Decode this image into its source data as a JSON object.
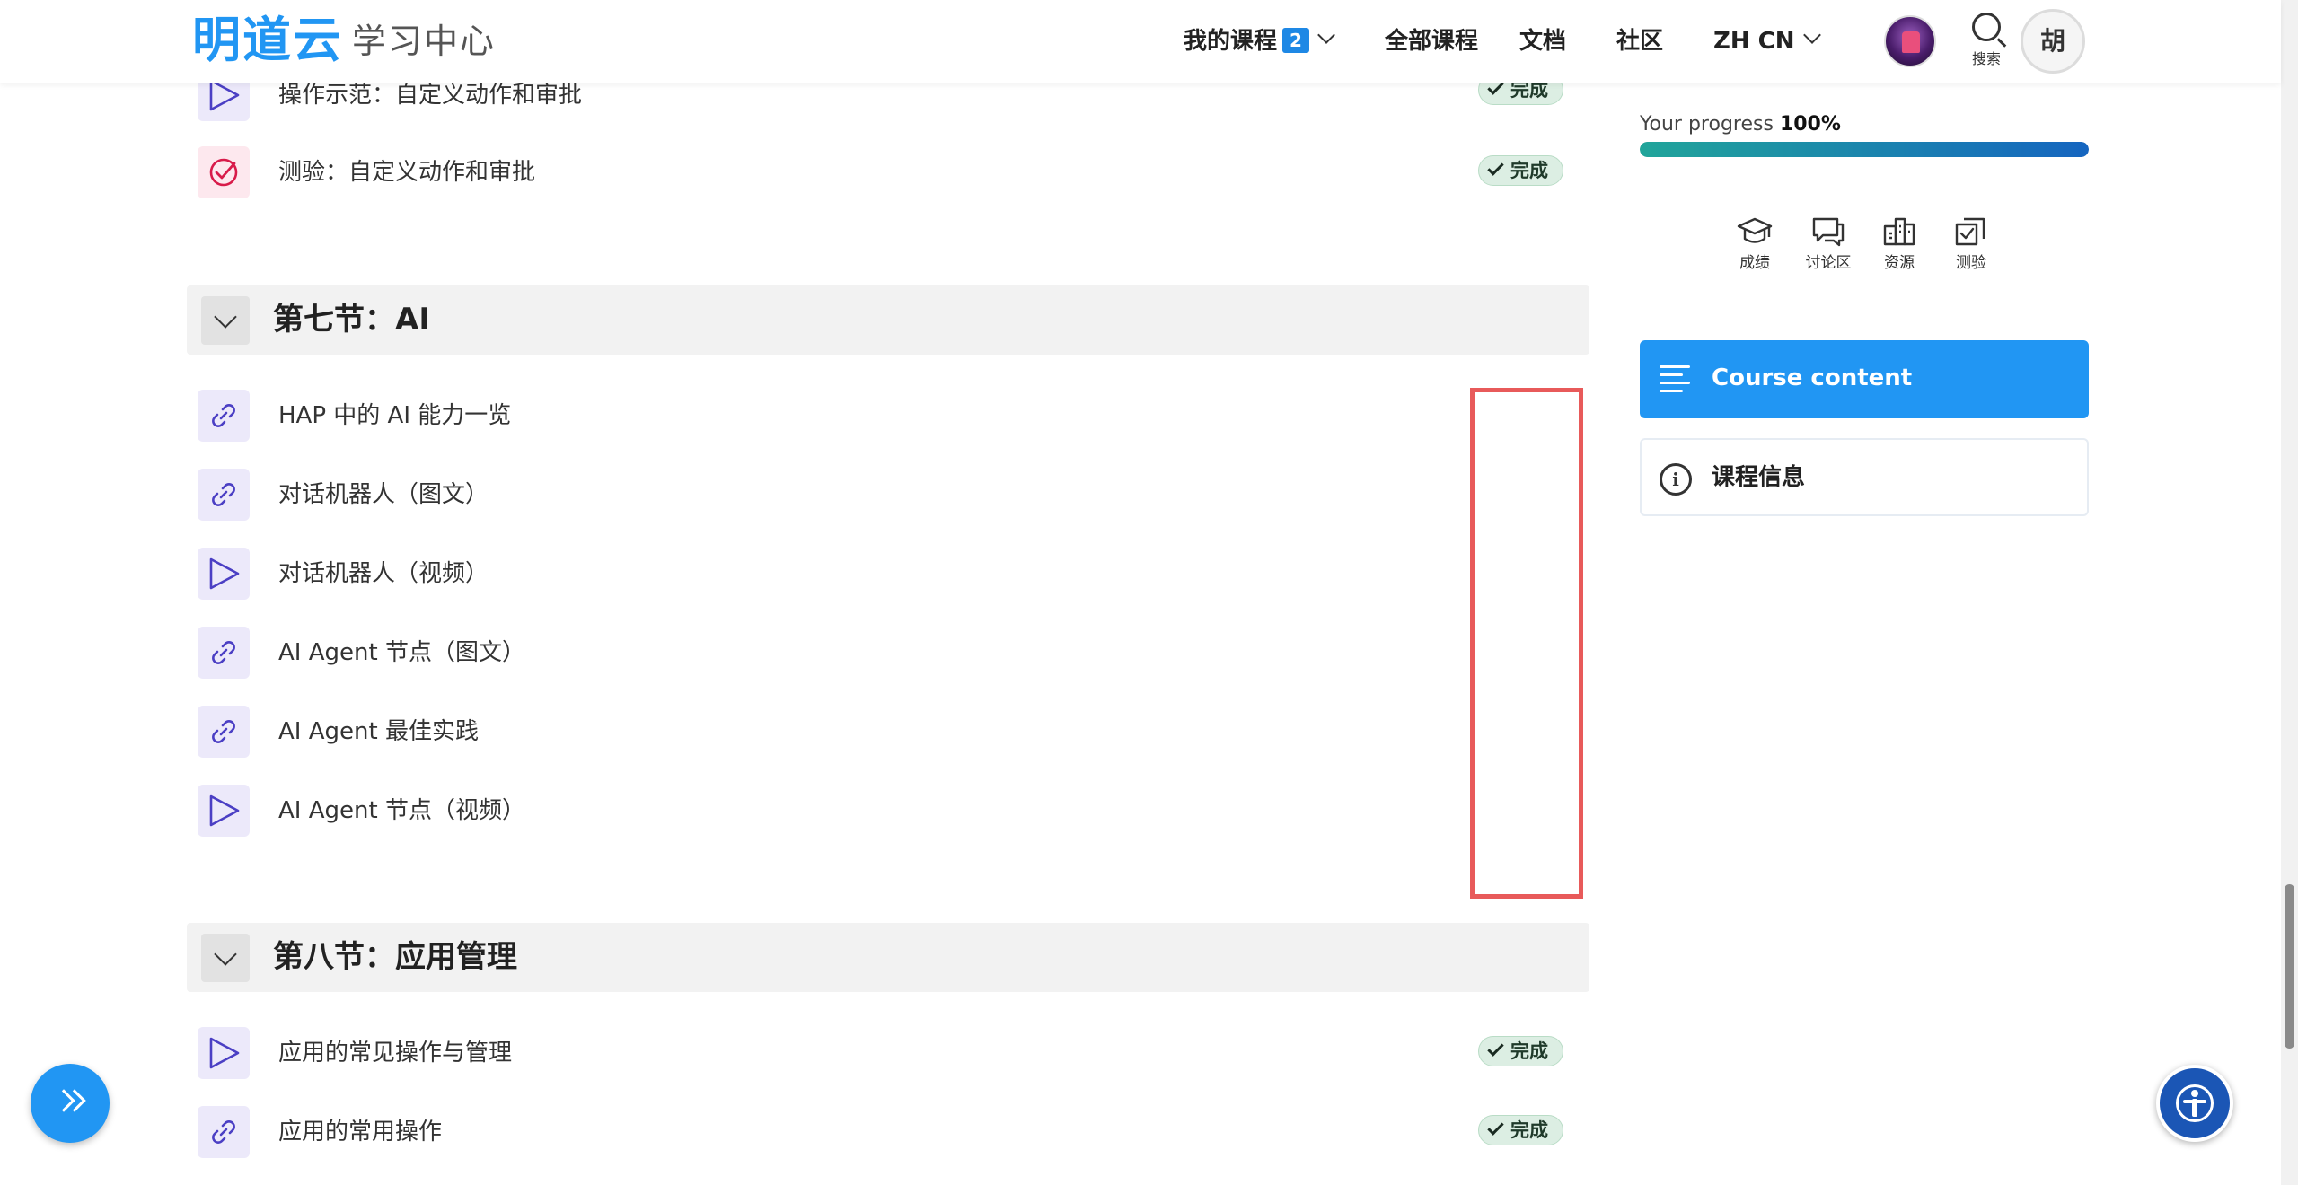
{
  "header": {
    "logo": "明道云",
    "subtitle": "学习中心",
    "nav": {
      "my_courses": "我的课程",
      "my_courses_count": "2",
      "all_courses": "全部课程",
      "docs": "文档",
      "community": "社区",
      "language": "ZH CN"
    },
    "search_label": "搜索",
    "user_initial": "胡"
  },
  "lessons_top": [
    {
      "title": "操作示范：自定义动作和审批",
      "type": "video",
      "status": "完成"
    },
    {
      "title": "测验：自定义动作和审批",
      "type": "quiz",
      "status": "完成"
    }
  ],
  "section7": {
    "title": "第七节：AI",
    "lessons": [
      {
        "title": "HAP 中的 AI 能力一览",
        "type": "link"
      },
      {
        "title": "对话机器人（图文）",
        "type": "link"
      },
      {
        "title": "对话机器人（视频）",
        "type": "video"
      },
      {
        "title": "AI Agent 节点（图文）",
        "type": "link"
      },
      {
        "title": "AI Agent 最佳实践",
        "type": "link"
      },
      {
        "title": "AI Agent 节点（视频）",
        "type": "video"
      }
    ]
  },
  "section8": {
    "title": "第八节：应用管理",
    "lessons": [
      {
        "title": "应用的常见操作与管理",
        "type": "video",
        "status": "完成"
      },
      {
        "title": "应用的常用操作",
        "type": "link",
        "status": "完成"
      }
    ]
  },
  "sidebar": {
    "progress_label": "Your progress",
    "progress_value": "100%",
    "progress_fraction": 1.0,
    "tools": [
      {
        "label": "成绩",
        "icon": "graduation-cap-icon"
      },
      {
        "label": "讨论区",
        "icon": "chat-icon"
      },
      {
        "label": "资源",
        "icon": "resources-icon"
      },
      {
        "label": "测验",
        "icon": "quiz-icon"
      }
    ],
    "course_content": "Course content",
    "course_info": "课程信息"
  },
  "colors": {
    "brand": "#2196f3",
    "highlight": "#e85a5a",
    "done_bg": "#dceee3",
    "icon_purple": "#4b3fc4"
  }
}
